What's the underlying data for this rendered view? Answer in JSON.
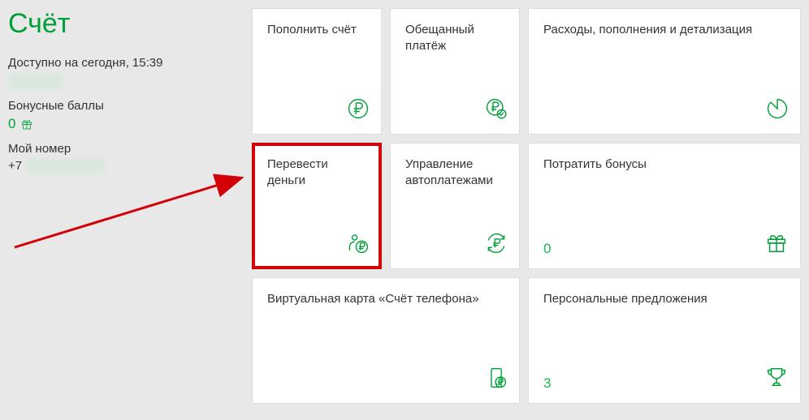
{
  "colors": {
    "accent": "#00a038",
    "highlight": "#d40007"
  },
  "sidebar": {
    "title": "Счёт",
    "available_label": "Доступно на сегодня, 15:39",
    "available_value_masked": "0000,00 ₽",
    "bonus_label": "Бонусные баллы",
    "bonus_value": "0",
    "phone_label": "Мой номер",
    "phone_prefix": "+7",
    "phone_tail_masked": "000 000 0000"
  },
  "tiles": {
    "topup": {
      "title": "Пополнить счёт"
    },
    "promised": {
      "title": "Обещанный платёж"
    },
    "details": {
      "title": "Расходы, пополнения и детализация"
    },
    "transfer": {
      "title": "Перевести деньги"
    },
    "autopay": {
      "title": "Управление автоплатежами"
    },
    "spend_bonus": {
      "title": "Потратить бонусы",
      "value": "0"
    },
    "vcard": {
      "title": "Виртуальная карта «Счёт телефона»"
    },
    "offers": {
      "title": "Персональные предложения",
      "value": "3"
    }
  }
}
